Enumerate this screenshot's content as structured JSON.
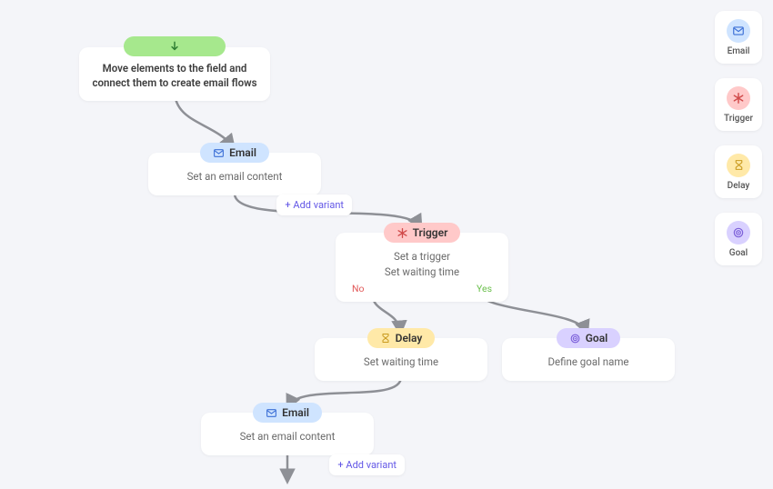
{
  "start": {
    "text": "Move elements to the field and connect them to create email flows"
  },
  "nodes": {
    "email1": {
      "label": "Email",
      "body": "Set an email content",
      "addVariant": "+ Add variant"
    },
    "trigger1": {
      "label": "Trigger",
      "line1": "Set a trigger",
      "line2": "Set waiting time",
      "noLabel": "No",
      "yesLabel": "Yes"
    },
    "delay1": {
      "label": "Delay",
      "body": "Set waiting time"
    },
    "goal1": {
      "label": "Goal",
      "body": "Define goal name"
    },
    "email2": {
      "label": "Email",
      "body": "Set an email content",
      "addVariant": "+ Add variant"
    }
  },
  "palette": {
    "email": "Email",
    "trigger": "Trigger",
    "delay": "Delay",
    "goal": "Goal"
  }
}
